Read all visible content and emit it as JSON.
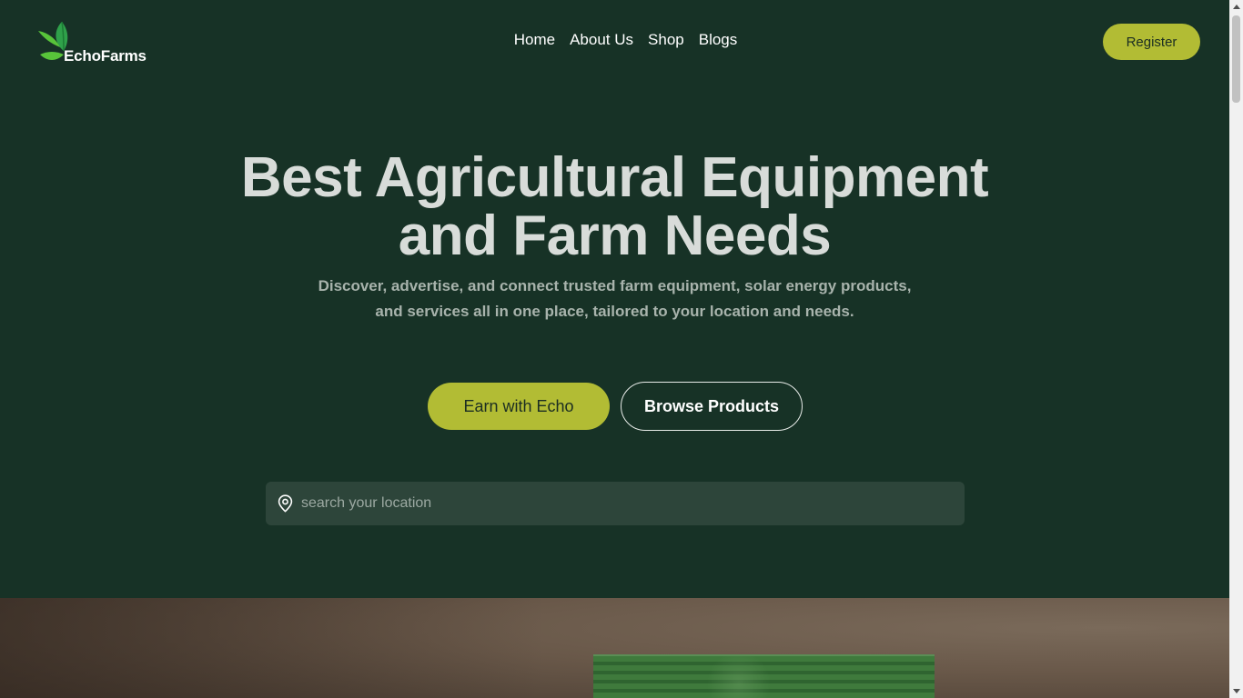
{
  "brand": {
    "name": "EchoFarms"
  },
  "nav": {
    "items": [
      {
        "label": "Home"
      },
      {
        "label": "About Us"
      },
      {
        "label": "Shop"
      },
      {
        "label": "Blogs"
      }
    ]
  },
  "header": {
    "register_label": "Register"
  },
  "hero": {
    "title_line1": "Best Agricultural Equipment",
    "title_line2": "and Farm Needs",
    "subtitle_line1": "Discover, advertise, and connect trusted farm equipment, solar energy products,",
    "subtitle_line2": "and services all in one place, tailored to your location and needs.",
    "primary_cta": "Earn with Echo",
    "secondary_cta": "Browse Products"
  },
  "search": {
    "placeholder": "search your location",
    "value": "",
    "icon": "location-pin-icon"
  },
  "colors": {
    "background": "#173226",
    "accent": "#b2bc34",
    "heading": "#d8dcd9",
    "subtitle": "#a8b3ac",
    "search_bg": "#2d453a"
  }
}
